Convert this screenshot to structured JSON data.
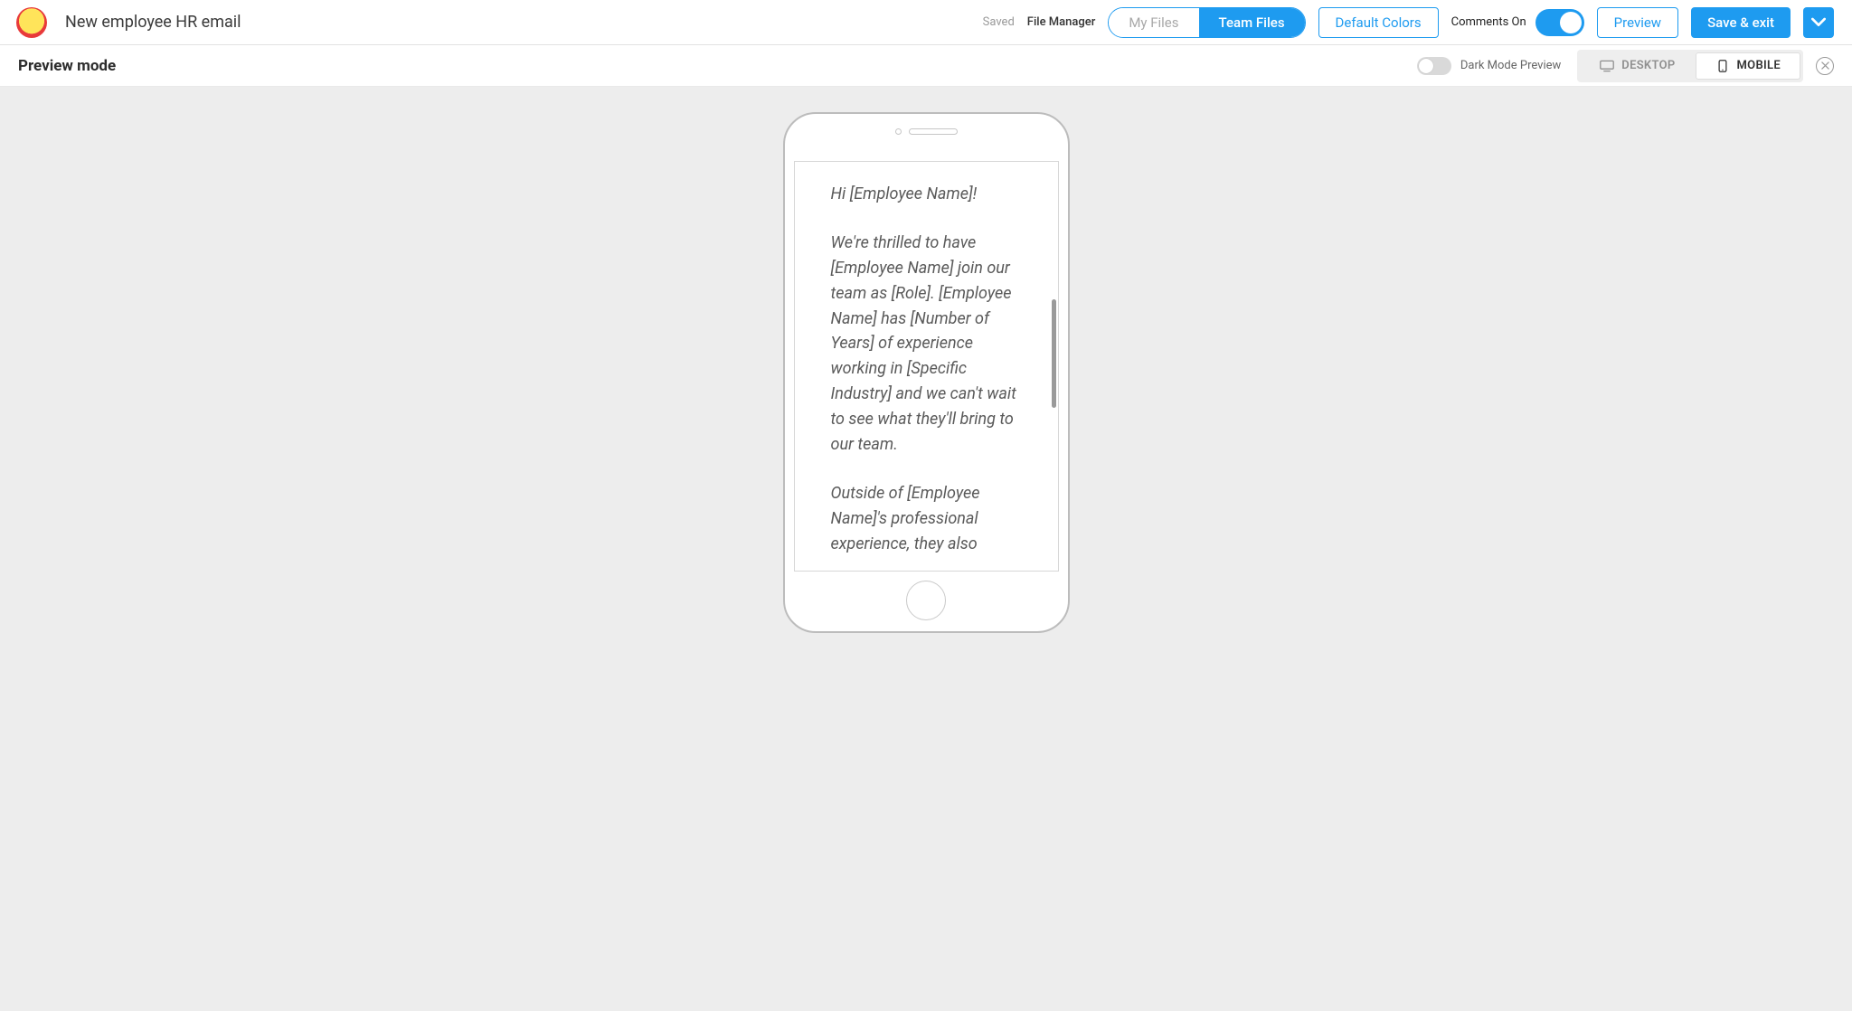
{
  "header": {
    "doc_title": "New employee HR email",
    "saved_label": "Saved",
    "file_manager_label": "File Manager",
    "files_toggle": {
      "inactive": "My Files",
      "active": "Team Files"
    },
    "default_colors_label": "Default Colors",
    "comments_label": "Comments On",
    "comments_on": true,
    "preview_label": "Preview",
    "save_exit_label": "Save & exit"
  },
  "second_bar": {
    "title": "Preview mode",
    "dark_mode_label": "Dark Mode Preview",
    "dark_mode_on": false,
    "device": {
      "desktop": "DESKTOP",
      "mobile": "MOBILE",
      "active": "mobile"
    }
  },
  "email": {
    "p1": "Hi [Employee Name]!",
    "p2": "We're thrilled to have [Employee Name] join our team as [Role]. [Employee Name] has [Number of Years] of experience working in [Specific Industry] and we can't wait to see what they'll bring to our team.",
    "p3": "Outside of [Employee Name]'s professional experience, they also"
  },
  "colors": {
    "accent": "#1e9bf0"
  }
}
